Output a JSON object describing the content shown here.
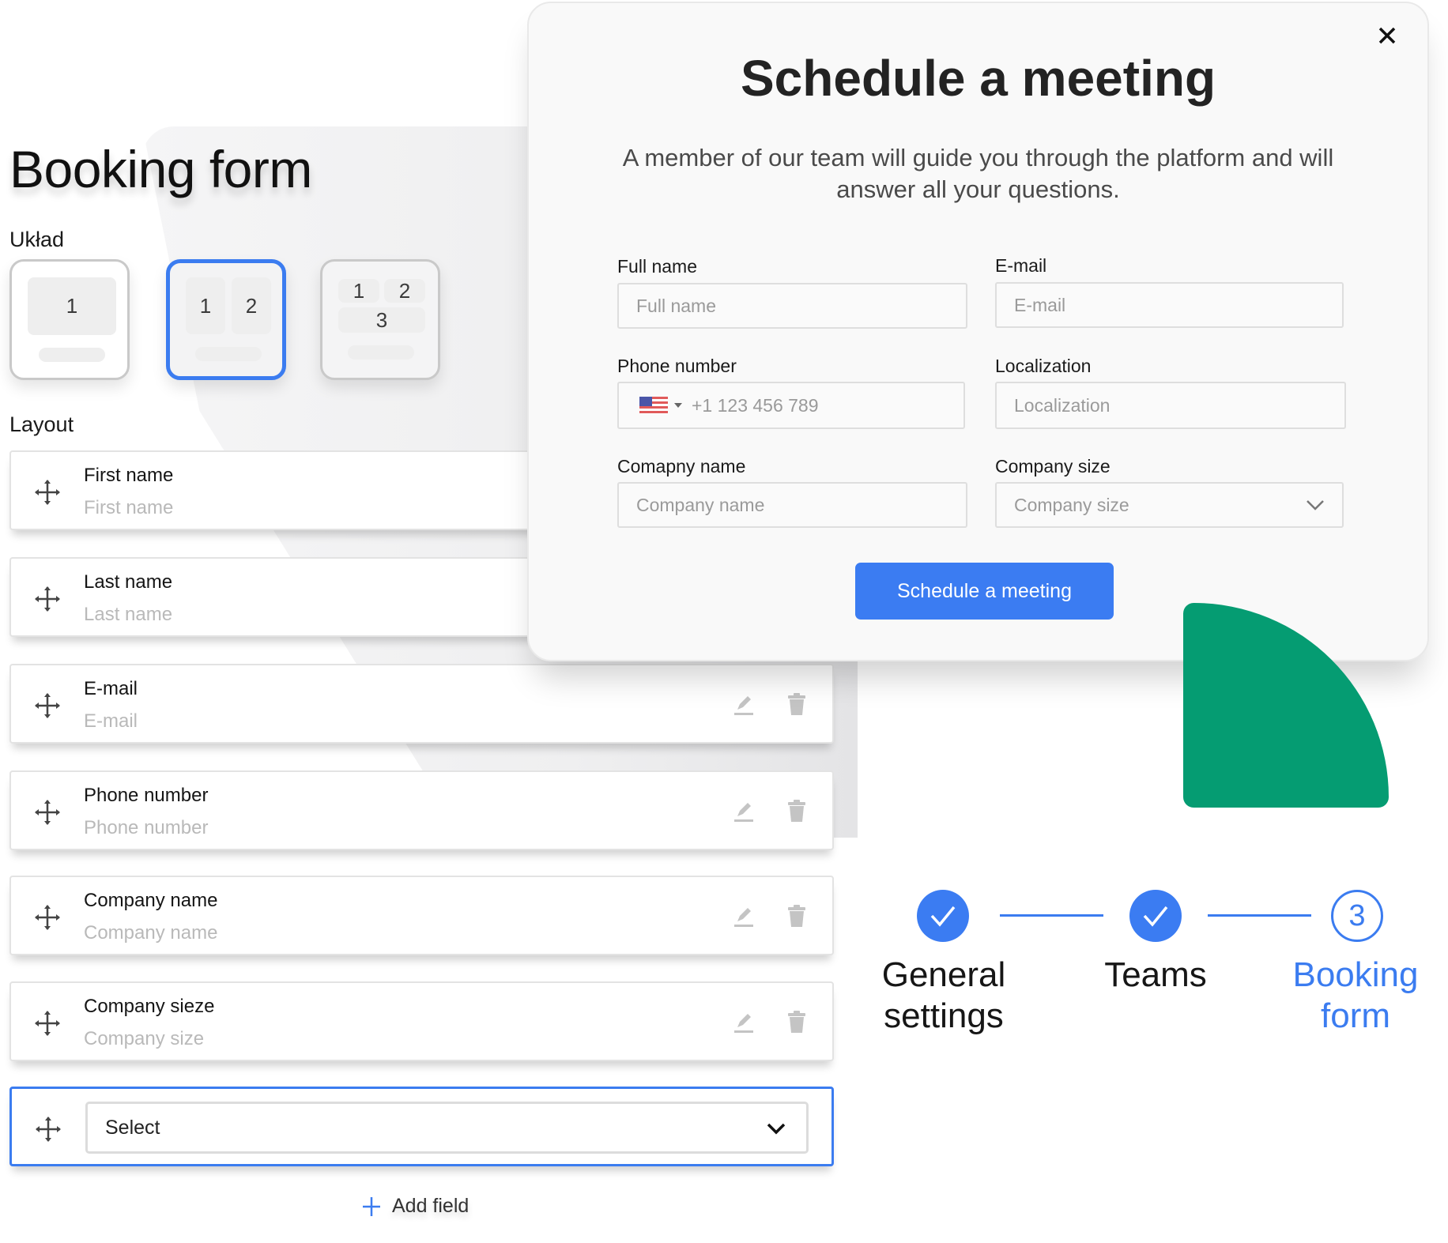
{
  "editor": {
    "title": "Booking form",
    "layout_section_label": "Układ",
    "fields_section_label": "Layout",
    "layout_options": [
      {
        "cells": [
          "1"
        ],
        "selected": false
      },
      {
        "cells": [
          "1",
          "2"
        ],
        "selected": true
      },
      {
        "cells": [
          "1",
          "2",
          "3"
        ],
        "selected": false
      }
    ],
    "fields": [
      {
        "label": "First name",
        "placeholder": "First name"
      },
      {
        "label": "Last name",
        "placeholder": "Last name"
      },
      {
        "label": "E-mail",
        "placeholder": "E-mail"
      },
      {
        "label": "Phone number",
        "placeholder": "Phone number"
      },
      {
        "label": "Company name",
        "placeholder": "Company name"
      },
      {
        "label": "Company sieze",
        "placeholder": "Company size"
      }
    ],
    "new_field_select": "Select",
    "add_field_label": "Add field"
  },
  "modal": {
    "title": "Schedule a meeting",
    "subtitle": "A member of our team will guide you through the platform and will answer all your questions.",
    "fields": {
      "full_name": {
        "label": "Full name",
        "placeholder": "Full name"
      },
      "email": {
        "label": "E-mail",
        "placeholder": "E-mail"
      },
      "phone": {
        "label": "Phone number",
        "placeholder": "+1 123 456 789",
        "country": "US"
      },
      "localization": {
        "label": "Localization",
        "placeholder": "Localization"
      },
      "company_name": {
        "label": "Comapny name",
        "placeholder": "Company name"
      },
      "company_size": {
        "label": "Company size",
        "placeholder": "Company size"
      }
    },
    "submit_label": "Schedule a meeting"
  },
  "stepper": {
    "steps": [
      {
        "label_line1": "General",
        "label_line2": "settings",
        "status": "done"
      },
      {
        "label_line1": "Teams",
        "label_line2": "",
        "status": "done"
      },
      {
        "label_line1": "Booking",
        "label_line2": "form",
        "status": "current",
        "number": "3"
      }
    ]
  },
  "colors": {
    "accent": "#3b7cf2",
    "green": "#059c72"
  }
}
